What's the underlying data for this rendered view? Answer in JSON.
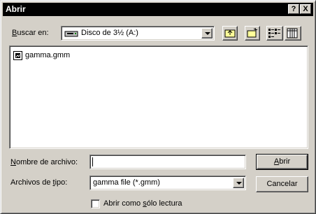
{
  "window": {
    "title": "Abrir"
  },
  "titlebar": {
    "help_label": "?",
    "close_label": "X"
  },
  "look_in": {
    "label_accel": "B",
    "label_rest": "uscar en:",
    "value": "Disco de 3½ (A:)"
  },
  "files": [
    {
      "name": "gamma.gmm"
    }
  ],
  "filename": {
    "label_accel": "N",
    "label_rest": "ombre de archivo:",
    "value": ""
  },
  "filetype": {
    "label_pre": "Archivos de ",
    "label_accel": "t",
    "label_post": "ipo:",
    "value": "gamma file (*.gmm)"
  },
  "buttons": {
    "open_accel": "A",
    "open_rest": "brir",
    "cancel": "Cancelar"
  },
  "readonly": {
    "label_pre": "Abrir como ",
    "label_accel": "s",
    "label_post": "ólo lectura",
    "checked": false
  }
}
